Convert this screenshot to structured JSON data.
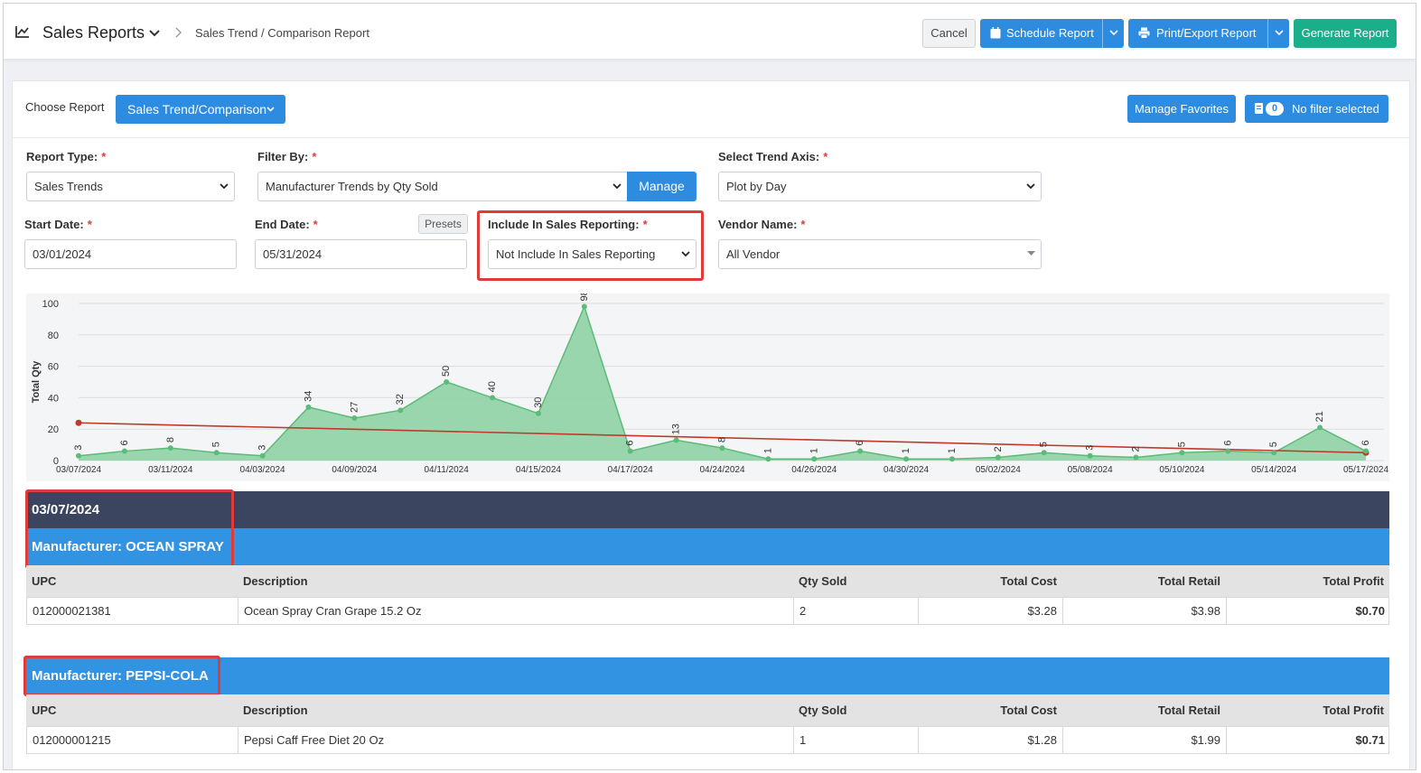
{
  "header": {
    "app_title": "Sales Reports",
    "breadcrumb": "Sales Trend / Comparison Report",
    "cancel_label": "Cancel",
    "schedule_label": "Schedule Report",
    "print_label": "Print/Export Report",
    "generate_label": "Generate Report"
  },
  "toolbar": {
    "choose_label": "Choose Report",
    "choose_value": "Sales Trend/Comparison",
    "favorites_label": "Manage Favorites",
    "filter_count": "0",
    "filter_label": "No filter selected"
  },
  "form": {
    "report_type_label": "Report Type:",
    "report_type_value": "Sales Trends",
    "filter_by_label": "Filter By:",
    "filter_by_value": "Manufacturer Trends by Qty Sold",
    "manage_label": "Manage",
    "trend_axis_label": "Select Trend Axis:",
    "trend_axis_value": "Plot by Day",
    "start_date_label": "Start Date:",
    "start_date_value": "03/01/2024",
    "end_date_label": "End Date:",
    "end_date_value": "05/31/2024",
    "presets_label": "Presets",
    "include_label": "Include In Sales Reporting:",
    "include_value": "Not Include In Sales Reporting",
    "vendor_label": "Vendor Name:",
    "vendor_value": "All Vendor",
    "required_mark": "*"
  },
  "chart_data": {
    "type": "area",
    "ylabel": "Total Qty",
    "ylim": [
      0,
      100
    ],
    "yticks": [
      0,
      20,
      40,
      60,
      80,
      100
    ],
    "grid": true,
    "x_tick_labels": [
      "03/07/2024",
      "03/11/2024",
      "04/03/2024",
      "04/09/2024",
      "04/11/2024",
      "04/15/2024",
      "04/17/2024",
      "04/24/2024",
      "04/26/2024",
      "04/30/2024",
      "05/02/2024",
      "05/08/2024",
      "05/10/2024",
      "05/14/2024",
      "05/17/2024"
    ],
    "values": [
      3,
      6,
      8,
      5,
      3,
      34,
      27,
      32,
      50,
      40,
      30,
      98,
      6,
      13,
      8,
      1,
      1,
      6,
      1,
      1,
      2,
      5,
      3,
      2,
      5,
      6,
      5,
      21,
      6
    ],
    "trend_line": {
      "start": 24,
      "end": 5
    },
    "area_color": "#8fd3a4",
    "line_color": "#5cbb78",
    "trend_color": "#c0392b"
  },
  "report": {
    "date": "03/07/2024",
    "groups": [
      {
        "manufacturer": "Manufacturer: OCEAN SPRAY",
        "columns": [
          "UPC",
          "Description",
          "Qty Sold",
          "Total Cost",
          "Total Retail",
          "Total Profit"
        ],
        "rows": [
          {
            "upc": "012000021381",
            "description": "Ocean Spray Cran Grape 15.2 Oz",
            "qty": "2",
            "cost": "$3.28",
            "retail": "$3.98",
            "profit": "$0.70"
          }
        ]
      },
      {
        "manufacturer": "Manufacturer: PEPSI-COLA",
        "columns": [
          "UPC",
          "Description",
          "Qty Sold",
          "Total Cost",
          "Total Retail",
          "Total Profit"
        ],
        "rows": [
          {
            "upc": "012000001215",
            "description": "Pepsi Caff Free Diet 20 Oz",
            "qty": "1",
            "cost": "$1.28",
            "retail": "$1.99",
            "profit": "$0.71"
          }
        ]
      }
    ]
  }
}
